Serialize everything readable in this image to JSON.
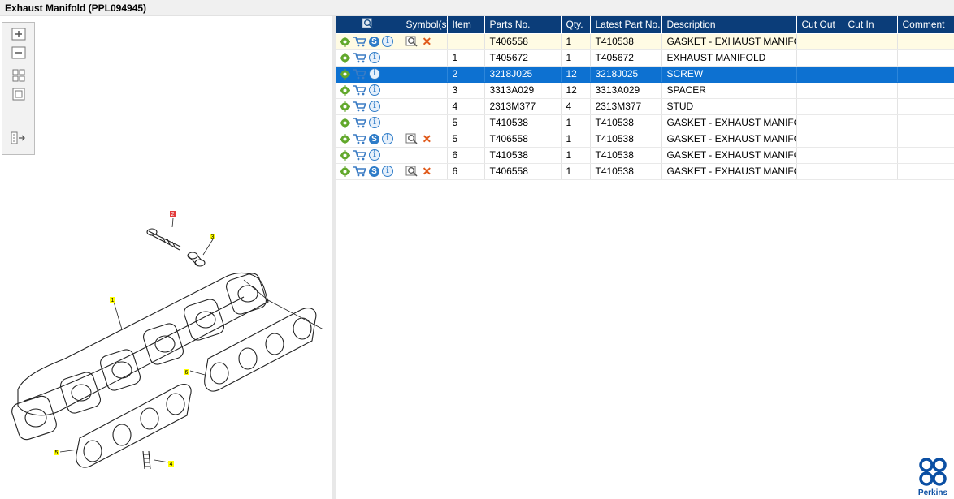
{
  "window": {
    "title": "Exhaust Manifold (PPL094945)"
  },
  "toolbox": {
    "buttons": [
      "zoom-in",
      "zoom-out",
      "fit-all",
      "fit-window",
      "toggle-layout"
    ]
  },
  "diagram": {
    "callouts": [
      "1",
      "2",
      "3",
      "4",
      "5",
      "6"
    ],
    "highlighted_callout": "2",
    "callout_color": "#ffff00",
    "highlight_color": "#e23a3a"
  },
  "grid": {
    "header_color": "#0b3d79",
    "selected_color": "#0d71d1",
    "columns": {
      "symbols": "Symbol(s)",
      "item": "Item",
      "parts_no": "Parts No.",
      "qty": "Qty.",
      "latest": "Latest Part No.",
      "description": "Description",
      "cut_out": "Cut Out",
      "cut_in": "Cut In",
      "comment": "Comment"
    },
    "rows": [
      {
        "item": "",
        "parts_no": "T406558",
        "qty": "1",
        "latest": "T410538",
        "description": "GASKET - EXHAUST MANIFOLD",
        "cut_out": "",
        "cut_in": "",
        "comment": ""
      },
      {
        "item": "1",
        "parts_no": "T405672",
        "qty": "1",
        "latest": "T405672",
        "description": "EXHAUST MANIFOLD",
        "cut_out": "",
        "cut_in": "",
        "comment": ""
      },
      {
        "item": "2",
        "parts_no": "3218J025",
        "qty": "12",
        "latest": "3218J025",
        "description": "SCREW",
        "cut_out": "",
        "cut_in": "",
        "comment": ""
      },
      {
        "item": "3",
        "parts_no": "3313A029",
        "qty": "12",
        "latest": "3313A029",
        "description": "SPACER",
        "cut_out": "",
        "cut_in": "",
        "comment": ""
      },
      {
        "item": "4",
        "parts_no": "2313M377",
        "qty": "4",
        "latest": "2313M377",
        "description": "STUD",
        "cut_out": "",
        "cut_in": "",
        "comment": ""
      },
      {
        "item": "5",
        "parts_no": "T410538",
        "qty": "1",
        "latest": "T410538",
        "description": "GASKET - EXHAUST MANIFOLD",
        "cut_out": "",
        "cut_in": "",
        "comment": ""
      },
      {
        "item": "5",
        "parts_no": "T406558",
        "qty": "1",
        "latest": "T410538",
        "description": "GASKET - EXHAUST MANIFOLD",
        "cut_out": "",
        "cut_in": "",
        "comment": ""
      },
      {
        "item": "6",
        "parts_no": "T410538",
        "qty": "1",
        "latest": "T410538",
        "description": "GASKET - EXHAUST MANIFOLD",
        "cut_out": "",
        "cut_in": "",
        "comment": ""
      },
      {
        "item": "6",
        "parts_no": "T406558",
        "qty": "1",
        "latest": "T410538",
        "description": "GASKET - EXHAUST MANIFOLD",
        "cut_out": "",
        "cut_in": "",
        "comment": ""
      }
    ]
  },
  "brand": {
    "name": "Perkins",
    "color": "#0b4fa3"
  }
}
